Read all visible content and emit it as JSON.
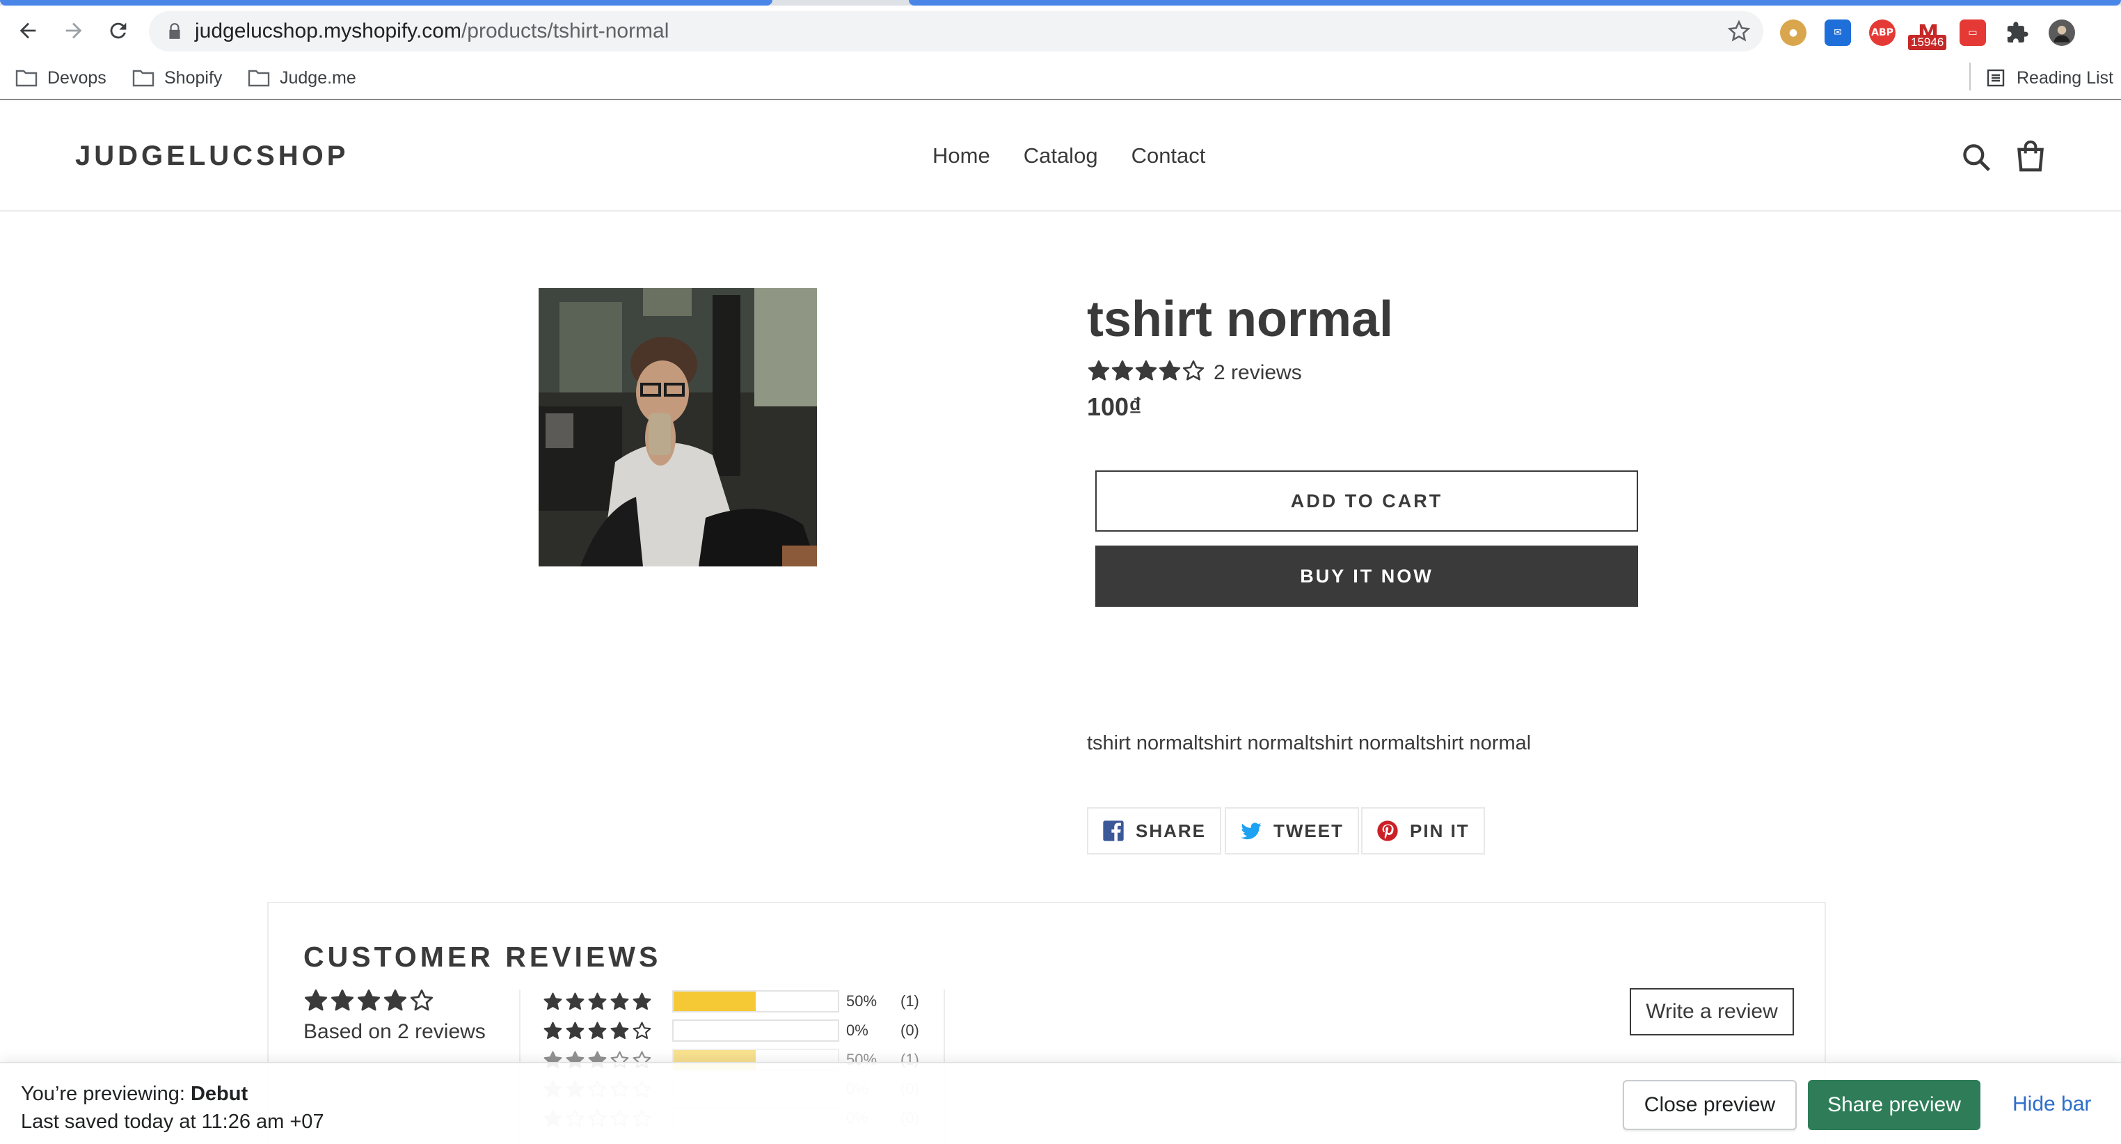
{
  "browser": {
    "url_host": "judgelucshop.myshopify.com",
    "url_path": "/products/tshirt-normal",
    "extension_badge": "15946",
    "abp_label": "ABP",
    "bookmarks": [
      "Devops",
      "Shopify",
      "Judge.me"
    ],
    "reading_list": "Reading List"
  },
  "header": {
    "logo": "JUDGELUCSHOP",
    "nav": [
      "Home",
      "Catalog",
      "Contact"
    ]
  },
  "product": {
    "title": "tshirt normal",
    "rating": 4,
    "reviews_label": "2 reviews",
    "price": "100₫",
    "add_to_cart": "ADD TO CART",
    "buy_now": "BUY IT NOW",
    "description": "tshirt normaltshirt normaltshirt normaltshirt normal",
    "social": {
      "share": "SHARE",
      "tweet": "TWEET",
      "pin": "PIN IT"
    }
  },
  "reviews": {
    "heading": "CUSTOMER REVIEWS",
    "average_stars": 4,
    "summary": "Based on 2 reviews",
    "write_review": "Write a review",
    "histogram": [
      {
        "stars": 5,
        "percent_value": 50,
        "percent": "50%",
        "count": "(1)"
      },
      {
        "stars": 4,
        "percent_value": 0,
        "percent": "0%",
        "count": "(0)"
      },
      {
        "stars": 3,
        "percent_value": 50,
        "percent": "50%",
        "count": "(1)"
      },
      {
        "stars": 2,
        "percent_value": 0,
        "percent": "0%",
        "count": "(0)"
      },
      {
        "stars": 1,
        "percent_value": 0,
        "percent": "0%",
        "count": "(0)"
      }
    ],
    "bar_color": "#f4c935"
  },
  "preview_bar": {
    "previewing_prefix": "You’re previewing:",
    "theme": "Debut",
    "saved": "Last saved today at 11:26 am +07",
    "close": "Close preview",
    "share": "Share preview",
    "hide": "Hide bar"
  }
}
